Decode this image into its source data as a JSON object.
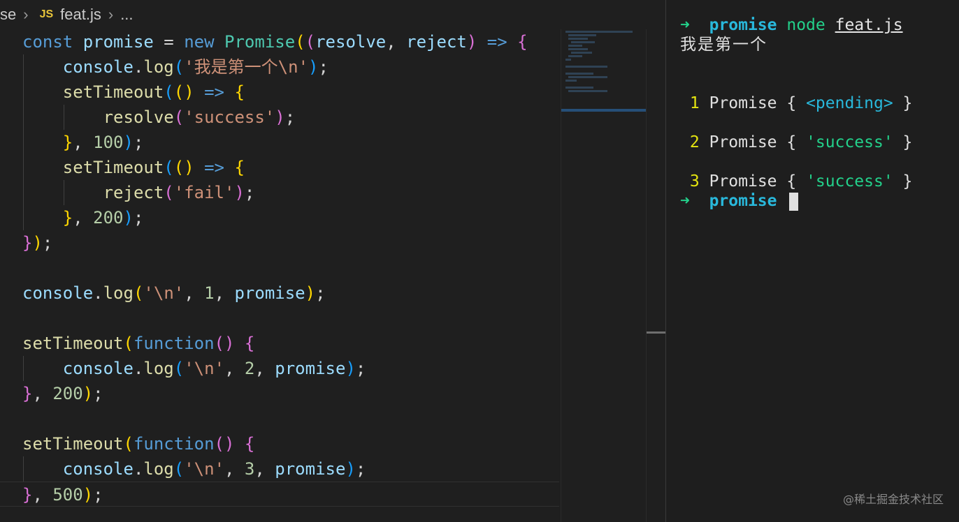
{
  "breadcrumb": {
    "parent": "se",
    "file_icon": "JS",
    "file": "feat.js",
    "ellipsis": "..."
  },
  "code": {
    "l1": {
      "const": "const",
      "promise": "promise",
      "eq": " = ",
      "new": "new",
      "Promise": "Promise",
      "p1": "(",
      "p2": "(",
      "resolve": "resolve",
      "comma": ", ",
      "reject": "reject",
      "p3": ")",
      "arrow": " => ",
      "brace": "{"
    },
    "l2": {
      "console": "console",
      "dot": ".",
      "log": "log",
      "p": "(",
      "str": "'我是第一个\\n'",
      "end": ");"
    },
    "l3": {
      "setTimeout": "setTimeout",
      "p1": "(",
      "p2": "()",
      "arrow": " => ",
      "brace": "{"
    },
    "l4": {
      "resolve": "resolve",
      "p": "(",
      "str": "'success'",
      "pe": ")",
      "semi": ";"
    },
    "l5": {
      "brace": "}",
      "comma": ", ",
      "num": "100",
      "p": ")",
      "semi": ";"
    },
    "l6": {
      "setTimeout": "setTimeout",
      "p1": "(",
      "p2": "()",
      "arrow": " => ",
      "brace": "{"
    },
    "l7": {
      "reject": "reject",
      "p": "(",
      "str": "'fail'",
      "pe": ")",
      "semi": ";"
    },
    "l8": {
      "brace": "}",
      "comma": ", ",
      "num": "200",
      "p": ")",
      "semi": ";"
    },
    "l9": {
      "brace": "}",
      "p": ")",
      "semi": ";"
    },
    "l11": {
      "console": "console",
      "dot": ".",
      "log": "log",
      "p": "(",
      "str": "'\\n'",
      "c1": ", ",
      "num": "1",
      "c2": ", ",
      "promise": "promise",
      "pe": ")",
      "semi": ";"
    },
    "l13": {
      "setTimeout": "setTimeout",
      "p": "(",
      "function": "function",
      "pp": "()",
      "sp": " ",
      "brace": "{"
    },
    "l14": {
      "console": "console",
      "dot": ".",
      "log": "log",
      "p": "(",
      "str": "'\\n'",
      "c1": ", ",
      "num": "2",
      "c2": ", ",
      "promise": "promise",
      "pe": ")",
      "semi": ";"
    },
    "l15": {
      "brace": "}",
      "comma": ", ",
      "num": "200",
      "p": ")",
      "semi": ";"
    },
    "l17": {
      "setTimeout": "setTimeout",
      "p": "(",
      "function": "function",
      "pp": "()",
      "sp": " ",
      "brace": "{"
    },
    "l18": {
      "console": "console",
      "dot": ".",
      "log": "log",
      "p": "(",
      "str": "'\\n'",
      "c1": ", ",
      "num": "3",
      "c2": ", ",
      "promise": "promise",
      "pe": ")",
      "semi": ";"
    },
    "l19": {
      "brace": "}",
      "comma": ", ",
      "num": "500",
      "p": ")",
      "semi": ";"
    }
  },
  "terminal": {
    "prompt_arrow": "➜",
    "dir": "promise",
    "cmd": "node",
    "arg": "feat.js",
    "out1": "我是第一个",
    "r1": {
      "n": "1",
      "text": "Promise { ",
      "val": "<pending>",
      "end": " }"
    },
    "r2": {
      "n": "2",
      "text": "Promise { ",
      "val": "'success'",
      "end": " }"
    },
    "r3": {
      "n": "3",
      "text": "Promise { ",
      "val": "'success'",
      "end": " }"
    }
  },
  "watermark": "@稀土掘金技术社区"
}
